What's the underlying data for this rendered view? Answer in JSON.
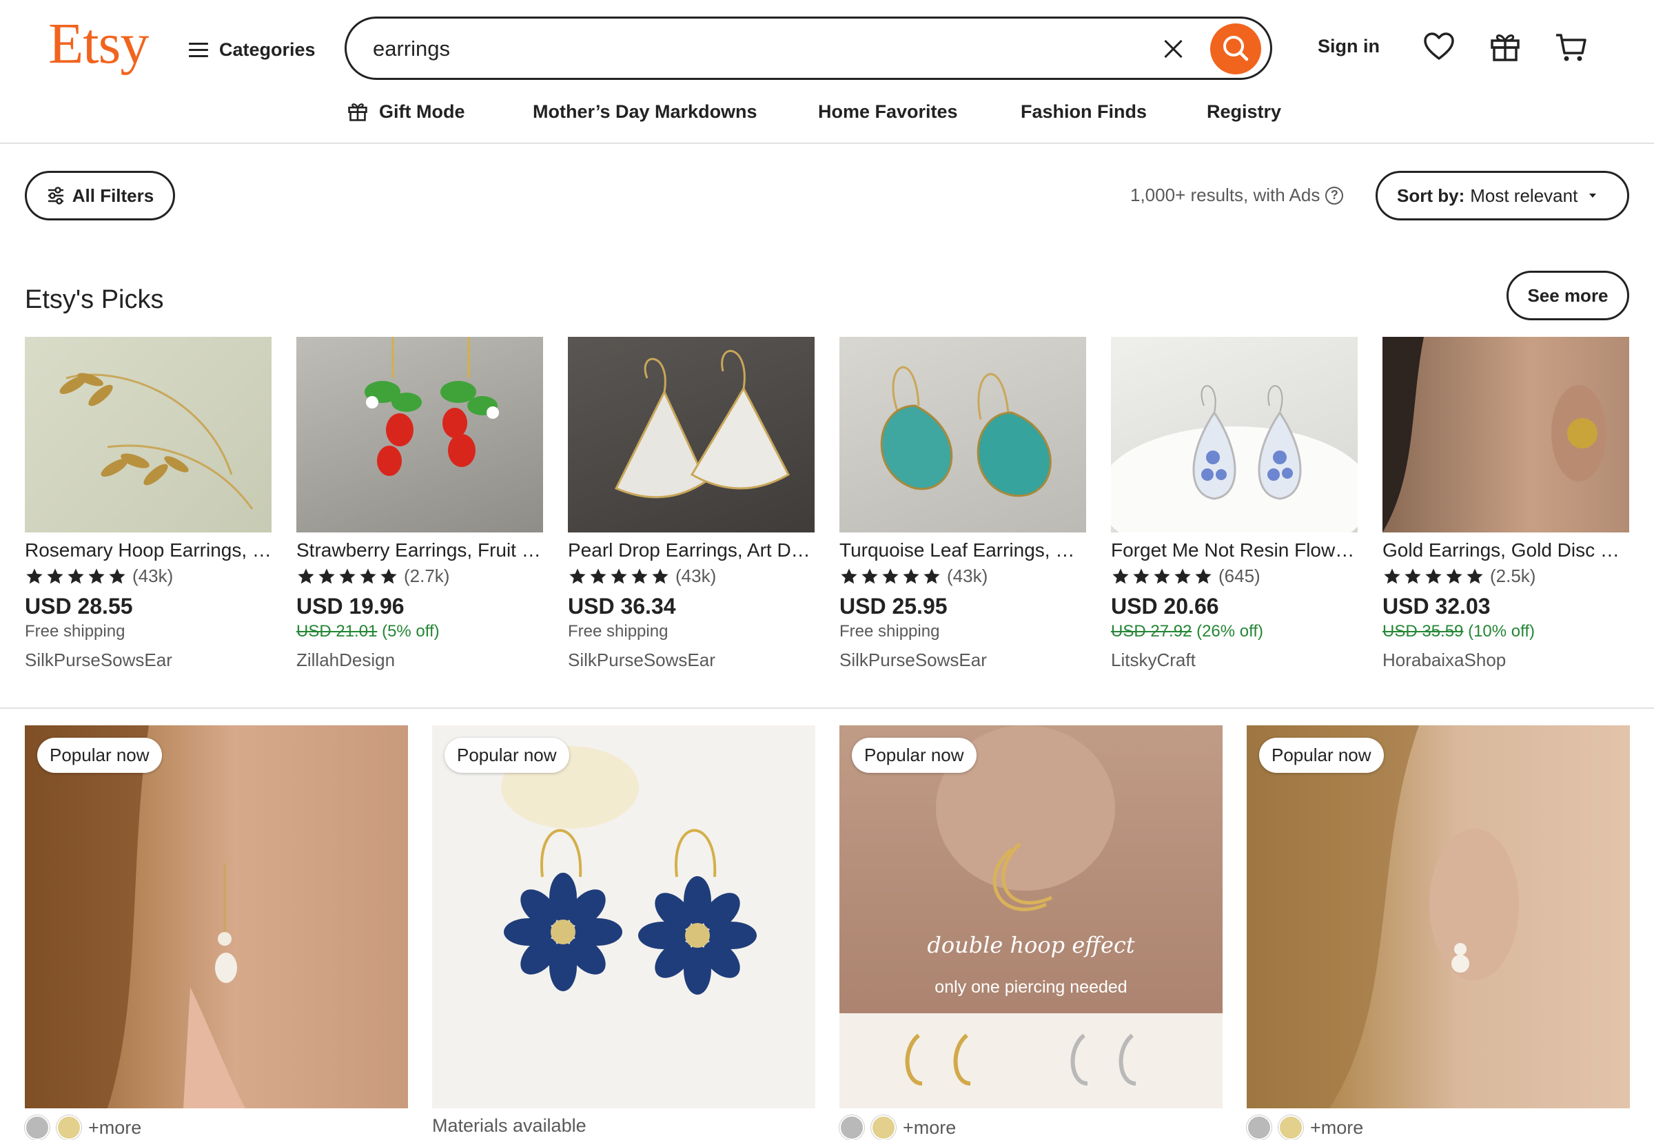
{
  "header": {
    "logo": "Etsy",
    "categories_label": "Categories",
    "search": {
      "value": "earrings"
    },
    "signin_label": "Sign in"
  },
  "nav": {
    "items": [
      "Gift Mode",
      "Mother’s Day Markdowns",
      "Home Favorites",
      "Fashion Finds",
      "Registry"
    ]
  },
  "filters": {
    "all_filters_label": "All Filters",
    "results_text": "1,000+ results, with Ads",
    "sort_prefix": "Sort by:",
    "sort_value": "Most relevant"
  },
  "picks": {
    "title": "Etsy's Picks",
    "see_more_label": "See more",
    "items": [
      {
        "title": "Rosemary Hoop Earrings, Gold Leaf",
        "reviews": "(43k)",
        "price": "USD 28.55",
        "shipping": "Free shipping",
        "original": "",
        "discount": "",
        "shop": "SilkPurseSowsEar"
      },
      {
        "title": "Strawberry Earrings, Fruit Earrings",
        "reviews": "(2.7k)",
        "price": "USD 19.96",
        "shipping": "",
        "original": "USD 21.01",
        "discount": "(5% off)",
        "shop": "ZillahDesign"
      },
      {
        "title": "Pearl Drop Earrings, Art Deco",
        "reviews": "(43k)",
        "price": "USD 36.34",
        "shipping": "Free shipping",
        "original": "",
        "discount": "",
        "shop": "SilkPurseSowsEar"
      },
      {
        "title": "Turquoise Leaf Earrings, Boho",
        "reviews": "(43k)",
        "price": "USD 25.95",
        "shipping": "Free shipping",
        "original": "",
        "discount": "",
        "shop": "SilkPurseSowsEar"
      },
      {
        "title": "Forget Me Not Resin Flower Earrings",
        "reviews": "(645)",
        "price": "USD 20.66",
        "shipping": "",
        "original": "USD 27.92",
        "discount": "(26% off)",
        "shop": "LitskyCraft"
      },
      {
        "title": "Gold Earrings, Gold Disc Studs",
        "reviews": "(2.5k)",
        "price": "USD 32.03",
        "shipping": "",
        "original": "USD 35.59",
        "discount": "(10% off)",
        "shop": "HorabaixaShop"
      }
    ]
  },
  "grid": {
    "badge": "Popular now",
    "items": [
      {
        "footer": "+more"
      },
      {
        "footer": "Materials available"
      },
      {
        "footer": "+more",
        "overlay_script": "double hoop effect",
        "overlay_text": "only one piercing needed"
      },
      {
        "footer": "+more"
      }
    ]
  },
  "colors": {
    "brand": "#F1641E",
    "discount": "#258635",
    "text": "#222222",
    "muted": "#595959"
  }
}
